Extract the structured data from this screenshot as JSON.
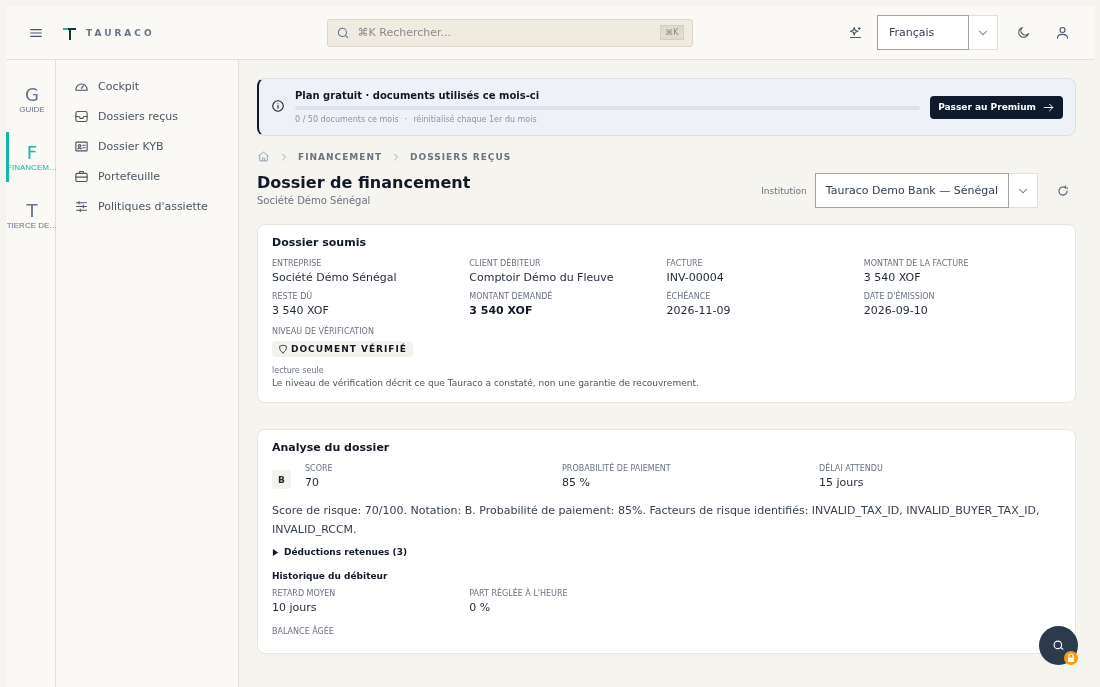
{
  "topbar": {
    "brand": "TAURACO",
    "search": {
      "placeholder": "⌘K Rechercher...",
      "shortcut": "⌘K"
    },
    "language": "Français"
  },
  "rail": [
    {
      "letter": "G",
      "label": "GUIDE",
      "selected": false
    },
    {
      "letter": "F",
      "label": "FINANCEM…",
      "selected": true
    },
    {
      "letter": "T",
      "label": "TIERCE DE…",
      "selected": false
    }
  ],
  "nav": [
    {
      "label": "Cockpit"
    },
    {
      "label": "Dossiers reçus"
    },
    {
      "label": "Dossier KYB"
    },
    {
      "label": "Portefeuille"
    },
    {
      "label": "Politiques d'assiette"
    }
  ],
  "plan_banner": {
    "title": "Plan gratuit · documents utilisés ce mois-ci",
    "level": 0,
    "usage": "0 / 50 documents ce mois",
    "separator": "·",
    "reset": "réinitialisé chaque 1er du mois",
    "button": "Passer au Premium"
  },
  "breadcrumb": [
    "FINANCEMENT",
    "DOSSIERS REÇUS"
  ],
  "header": {
    "title": "Dossier de financement",
    "subtitle": "Société Démo Sénégal",
    "institution_label": "Institution",
    "institution": "Tauraco Demo Bank — Sénégal"
  },
  "submitted": {
    "title": "Dossier soumis",
    "fields": [
      {
        "label": "ENTREPRISE",
        "value": "Société Démo Sénégal",
        "emphasis": false
      },
      {
        "label": "CLIENT DÉBITEUR",
        "value": "Comptoir Démo du Fleuve",
        "emphasis": false
      },
      {
        "label": "FACTURE",
        "value": "INV-00004",
        "emphasis": false
      },
      {
        "label": "MONTANT DE LA FACTURE",
        "value": "3 540 XOF",
        "emphasis": false
      },
      {
        "label": "RESTE DÛ",
        "value": "3 540 XOF",
        "emphasis": false
      },
      {
        "label": "MONTANT DEMANDÉ",
        "value": "3 540 XOF",
        "emphasis": true
      },
      {
        "label": "ÉCHÉANCE",
        "value": "2026-11-09",
        "emphasis": false
      },
      {
        "label": "DATE D'ÉMISSION",
        "value": "2026-09-10",
        "emphasis": false
      }
    ],
    "verification_label": "NIVEAU DE VÉRIFICATION",
    "verification": "DOCUMENT VÉRIFIÉ",
    "readonly": "lecture seule",
    "note": "Le niveau de vérification décrit ce que Tauraco a constaté, non une garantie de recouvrement."
  },
  "analysis": {
    "title": "Analyse du dossier",
    "grade": "B",
    "metrics": [
      {
        "label": "SCORE",
        "value": "70"
      },
      {
        "label": "PROBABILITÉ DE PAIEMENT",
        "value": "85 %"
      },
      {
        "label": "DÉLAI ATTENDU",
        "value": "15 jours"
      }
    ],
    "summary": "Score de risque: 70/100. Notation: B. Probabilité de paiement: 85%. Facteurs de risque identifiés: INVALID_TAX_ID, INVALID_BUYER_TAX_ID, INVALID_RCCM.",
    "deductions": {
      "label": "Déductions retenues (3)",
      "expanded": false
    },
    "history_title": "Historique du débiteur",
    "history": [
      {
        "label": "RETARD MOYEN",
        "value": "10 jours"
      },
      {
        "label": "PART RÉGLÉE À L'HEURE",
        "value": "0 %"
      }
    ],
    "aged_label": "BALANCE ÂGÉE"
  }
}
